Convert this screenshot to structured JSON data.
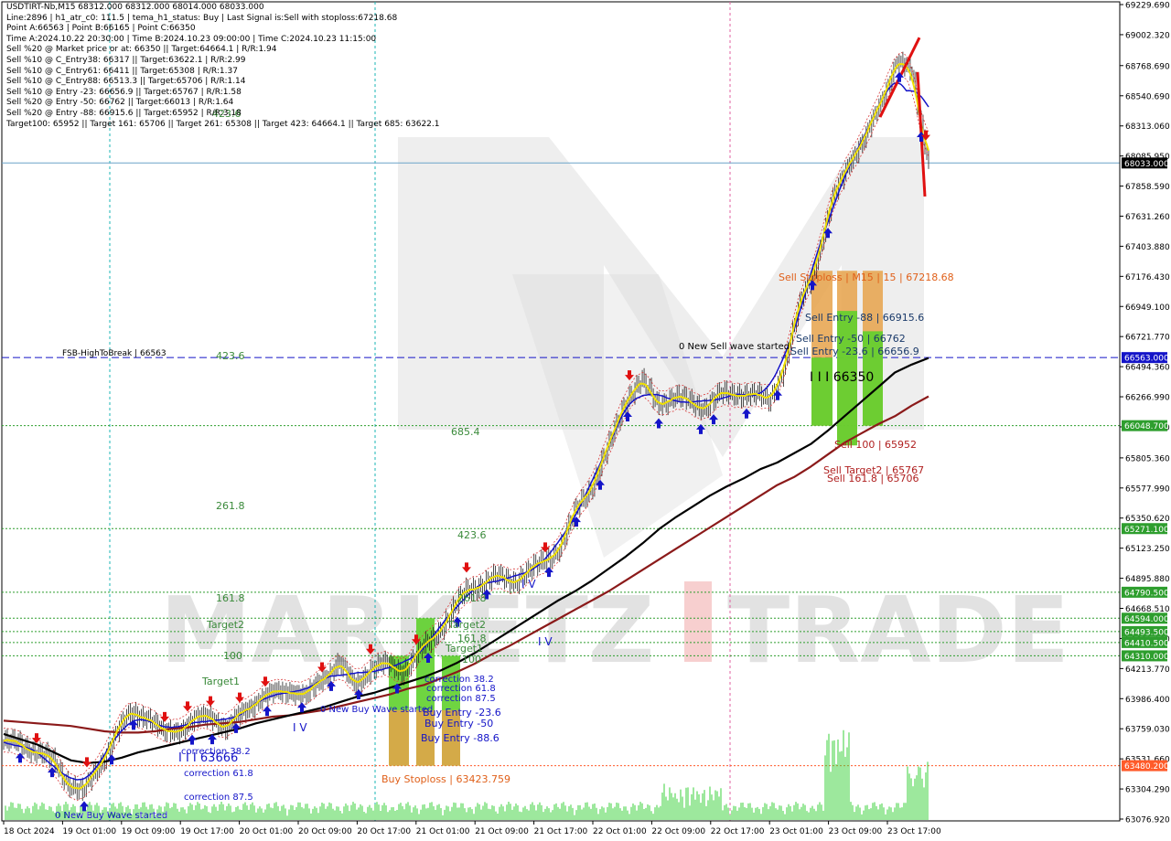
{
  "window": {
    "symbol_header": "USDTIRT-Nb,M15 68312.000 68312.000 68014.000 68033.000"
  },
  "info_panel": {
    "lines": [
      "Line:2896 | h1_atr_c0: 111.5 | tema_h1_status: Buy | Last Signal is:Sell with stoploss:67218.68",
      "Point A:66563 | Point B:66165 | Point C:66350",
      "Time A:2024.10.22 20:30:00 | Time B:2024.10.23 09:00:00 | Time C:2024.10.23 11:15:00",
      "Sell %20 @ Market price or at: 66350 || Target:64664.1 | R/R:1.94",
      "Sell %10 @ C_Entry38: 66317 || Target:63622.1 | R/R:2.99",
      "Sell %10 @ C_Entry61: 66411 || Target:65308 | R/R:1.37",
      "Sell %10 @ C_Entry88: 66513.3 || Target:65706 | R/R:1.14",
      "Sell %10 @ Entry -23: 66656.9 || Target:65767 | R/R:1.58",
      "Sell %20 @ Entry -50: 66762 || Target:66013 | R/R:1.64",
      "Sell %20 @ Entry -88: 66915.6 || Target:65952 | R/R:3.18",
      "Target100: 65952 || Target 161: 65706 || Target 261: 65308 || Target 423: 64664.1 || Target 685: 63622.1"
    ]
  },
  "watermark": {
    "left": "MARKETZ",
    "i": "I",
    "right": "TRADE"
  },
  "price_axis": {
    "ticks": [
      "69229.690",
      "69002.320",
      "68768.690",
      "68540.690",
      "68313.060",
      "68085.950",
      "67858.590",
      "67631.260",
      "67403.880",
      "67176.430",
      "66949.100",
      "66721.770",
      "66494.360",
      "66266.990",
      "66039.640",
      "65805.360",
      "65577.990",
      "65350.620",
      "65123.250",
      "64895.880",
      "64668.510",
      "64441.140",
      "64213.770",
      "63986.400",
      "63759.030",
      "63531.660",
      "63304.290",
      "63076.920"
    ],
    "ticks_num": [
      69229.69,
      69002.32,
      68768.69,
      68540.69,
      68313.06,
      68085.95,
      67858.59,
      67631.26,
      67403.88,
      67176.43,
      66949.1,
      66721.77,
      66494.36,
      66266.99,
      66039.64,
      65805.36,
      65577.99,
      65350.62,
      65123.25,
      64895.88,
      64668.51,
      64441.14,
      64213.77,
      63986.4,
      63759.03,
      63531.66,
      63304.29,
      63076.92
    ],
    "current_price": {
      "label": "68033.000",
      "value": 68033
    },
    "level_badges": [
      {
        "label": "66563.000",
        "value": 66563,
        "bg": "#1414c8"
      },
      {
        "label": "66048.700",
        "value": 66048.7,
        "bg": "#2e9e2e"
      },
      {
        "label": "65271.100",
        "value": 65271.1,
        "bg": "#2e9e2e"
      },
      {
        "label": "64790.500",
        "value": 64790.5,
        "bg": "#2e9e2e"
      },
      {
        "label": "64594.000",
        "value": 64594,
        "bg": "#2e9e2e"
      },
      {
        "label": "64493.500",
        "value": 64493.5,
        "bg": "#2e9e2e"
      },
      {
        "label": "64410.500",
        "value": 64410.5,
        "bg": "#2e9e2e"
      },
      {
        "label": "64310.000",
        "value": 64310,
        "bg": "#2e9e2e"
      },
      {
        "label": "63480.200",
        "value": 63480.2,
        "bg": "#ff5b2a"
      }
    ]
  },
  "time_axis": {
    "labels": [
      "18 Oct 2024",
      "19 Oct 01:00",
      "19 Oct 09:00",
      "19 Oct 17:00",
      "20 Oct 01:00",
      "20 Oct 09:00",
      "20 Oct 17:00",
      "21 Oct 01:00",
      "21 Oct 09:00",
      "21 Oct 17:00",
      "22 Oct 01:00",
      "22 Oct 09:00",
      "22 Oct 17:00",
      "23 Oct 01:00",
      "23 Oct 09:00",
      "23 Oct 17:00"
    ]
  },
  "annotations": {
    "fsb_label": "FSB-HighToBreak | 66563",
    "new_sell_wave": "0 New Sell wave started",
    "new_buy_wave_1": "0 New Buy Wave started",
    "new_buy_wave_2": "0 New Buy Wave started",
    "sell_stoploss": "Sell Stoploss | M15 | 15 | 67218.68",
    "sell_entry_88": "Sell Entry -88 | 66915.6",
    "sell_entry_50": "Sell Entry -50 | 66762",
    "sell_entry_23": "Sell Entry -23.6 | 66656.9",
    "point_c_marker": "I I I 66350",
    "sell_100": "Sell 100 | 65952",
    "sell_target2": "Sell Target2 | 65767",
    "sell_161": "Sell 161.8 | 65706",
    "buy_stoploss": "Buy Stoploss | 63423.759",
    "buy_entry_88": "Buy Entry -88.6",
    "buy_entry_50": "Buy Entry -50",
    "buy_entry_23": "Buy Entry -23.6",
    "correction_38_mid": "correction 38.2",
    "correction_61_mid": "correction 61.8",
    "correction_87_mid": "correction 87.5",
    "correction_38_left": "correction 38.2",
    "correction_61_left": "correction 61.8",
    "correction_87_left": "correction 87.5",
    "left_marker": "I I I 63666",
    "iv_mid": "I V",
    "iv_right": "I V",
    "iv_left": "I V",
    "fib_left_4236_top": "423.6",
    "fib_left_261": "261.8",
    "fib_left_161": "161.8",
    "fib_left_target2": "Target2",
    "fib_left_100": "100",
    "fib_left_target1": "Target1",
    "fib_mid_4236": "423.6",
    "fib_mid_685": "685.4",
    "fib_mid_4236b": "423.6",
    "fib_mid_261": "261.8",
    "fib_mid_target2": "Target2",
    "fib_mid_161": "161.8",
    "fib_mid_target1": "Target1",
    "fib_mid_100": "100",
    "fib_top_685": "685.4"
  },
  "chart_data": {
    "type": "line",
    "symbol": "USDTIRT-Nb",
    "timeframe": "M15",
    "ylim": [
      63076.92,
      69229.69
    ],
    "x_tick_labels": [
      "18 Oct 2024",
      "19 Oct 01:00",
      "19 Oct 09:00",
      "19 Oct 17:00",
      "20 Oct 01:00",
      "20 Oct 09:00",
      "20 Oct 17:00",
      "21 Oct 01:00",
      "21 Oct 09:00",
      "21 Oct 17:00",
      "22 Oct 01:00",
      "22 Oct 09:00",
      "22 Oct 17:00",
      "23 Oct 01:00",
      "23 Oct 09:00",
      "23 Oct 17:00"
    ],
    "ohlc_last": {
      "open": 68312.0,
      "high": 68312.0,
      "low": 68014.0,
      "close": 68033.0
    },
    "close_anchors": [
      63660,
      63640,
      63600,
      63520,
      63360,
      63280,
      63480,
      63720,
      63880,
      63860,
      63720,
      63760,
      63820,
      63860,
      63760,
      63880,
      63990,
      64020,
      64060,
      64000,
      64140,
      64260,
      64080,
      64220,
      64240,
      64200,
      64320,
      64460,
      64620,
      64800,
      64860,
      64900,
      64880,
      64940,
      65040,
      65140,
      65440,
      65620,
      65900,
      66250,
      66380,
      66220,
      66260,
      66230,
      66190,
      66280,
      66300,
      66270,
      66250,
      66500,
      67000,
      67300,
      67750,
      68050,
      68200,
      68500,
      68800,
      68700,
      68033
    ],
    "series": [
      {
        "name": "EMA 50",
        "color": "#000000",
        "values": [
          63720,
          63680,
          63640,
          63580,
          63520,
          63500,
          63510,
          63540,
          63580,
          63610,
          63640,
          63670,
          63700,
          63730,
          63760,
          63800,
          63830,
          63860,
          63890,
          63920,
          63960,
          64000,
          64030,
          64070,
          64110,
          64150,
          64200,
          64260,
          64330,
          64410,
          64490,
          64570,
          64650,
          64730,
          64800,
          64880,
          64970,
          65060,
          65160,
          65270,
          65360,
          65440,
          65520,
          65590,
          65650,
          65720,
          65770,
          65840,
          65910,
          66010,
          66120,
          66230,
          66340,
          66450,
          66510,
          66560
        ]
      },
      {
        "name": "EMA 200",
        "color": "#8b1a1a",
        "values": [
          63820,
          63810,
          63800,
          63790,
          63780,
          63760,
          63740,
          63730,
          63730,
          63740,
          63760,
          63770,
          63790,
          63800,
          63810,
          63830,
          63850,
          63860,
          63880,
          63900,
          63930,
          63960,
          63990,
          64020,
          64060,
          64090,
          64140,
          64190,
          64250,
          64320,
          64380,
          64450,
          64520,
          64590,
          64660,
          64730,
          64800,
          64880,
          64960,
          65040,
          65120,
          65200,
          65280,
          65360,
          65440,
          65520,
          65600,
          65660,
          65740,
          65830,
          65920,
          65990,
          66060,
          66120,
          66200,
          66270
        ]
      }
    ],
    "horizontal_levels": [
      {
        "label": "FSB-HighToBreak | 66563",
        "value": 66563,
        "style": "dashed",
        "color": "#1414c8"
      },
      {
        "value": 66048.7,
        "style": "dotted",
        "color": "#2e9e2e"
      },
      {
        "value": 65271.1,
        "style": "dotted",
        "color": "#2e9e2e"
      },
      {
        "value": 64790.5,
        "style": "dotted",
        "color": "#2e9e2e"
      },
      {
        "value": 64594,
        "style": "dotted",
        "color": "#2e9e2e"
      },
      {
        "value": 64493.5,
        "style": "dotted",
        "color": "#2e9e2e"
      },
      {
        "value": 64410.5,
        "style": "dotted",
        "color": "#2e9e2e"
      },
      {
        "value": 64310,
        "style": "dotted",
        "color": "#2e9e2e"
      },
      {
        "value": 63480.2,
        "style": "dotted",
        "color": "#ff5b2a"
      },
      {
        "value": 68033,
        "style": "solid",
        "color": "#6ba3c9"
      }
    ],
    "signal_points": {
      "point_a": 66563,
      "point_b": 66165,
      "point_c": 66350,
      "sell_stoploss": 67218.68,
      "sell_entries": [
        66915.6,
        66762,
        66656.9
      ],
      "sell_targets": [
        65952,
        65767,
        65706
      ],
      "buy_stoploss": 63423.759
    },
    "colors": {
      "ema_fast": "#1414c8",
      "tema": "#f0e000",
      "entry_box_green": "#5fd02c",
      "stop_box_orange": "#e6a24a",
      "sell_text": "#b02020",
      "buy_text": "#1414c8"
    }
  }
}
